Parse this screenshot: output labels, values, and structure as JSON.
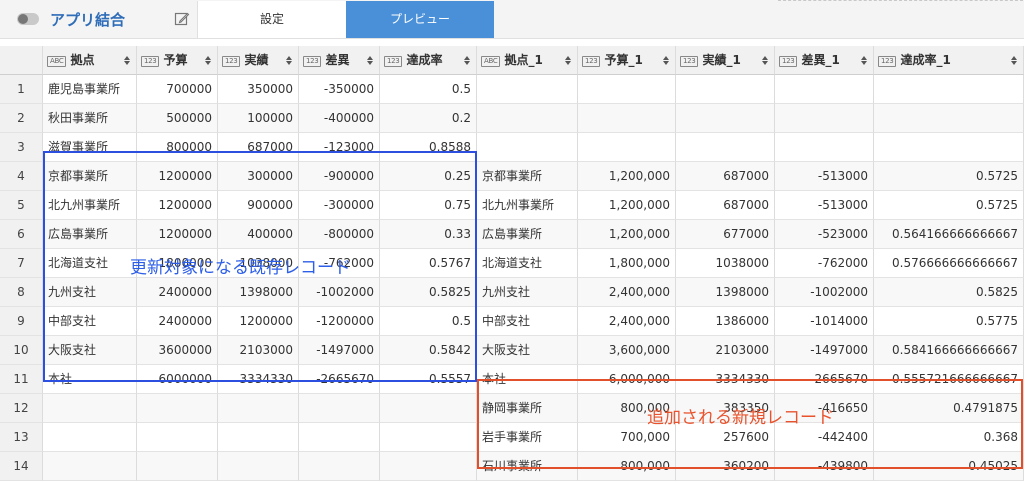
{
  "app": {
    "title": "アプリ結合",
    "toggle_icon": "toggle-icon",
    "edit_icon": "edit-icon"
  },
  "tabs": [
    {
      "label": "設定",
      "active": false
    },
    {
      "label": "プレビュー",
      "active": true
    }
  ],
  "colors": {
    "accent": "#4a90d9",
    "title": "#2f6db8",
    "annotation_blue": "#2d4fe0",
    "annotation_red": "#e2502b"
  },
  "table": {
    "columns": [
      {
        "label": "拠点",
        "type": "ABC"
      },
      {
        "label": "予算",
        "type": "123"
      },
      {
        "label": "実績",
        "type": "123"
      },
      {
        "label": "差異",
        "type": "123"
      },
      {
        "label": "達成率",
        "type": "123"
      },
      {
        "label": "拠点_1",
        "type": "ABC"
      },
      {
        "label": "予算_1",
        "type": "123"
      },
      {
        "label": "実績_1",
        "type": "123"
      },
      {
        "label": "差異_1",
        "type": "123"
      },
      {
        "label": "達成率_1",
        "type": "123"
      }
    ],
    "rows": [
      [
        "1",
        "鹿児島事業所",
        "700000",
        "350000",
        "-350000",
        "0.5",
        "",
        "",
        "",
        "",
        ""
      ],
      [
        "2",
        "秋田事業所",
        "500000",
        "100000",
        "-400000",
        "0.2",
        "",
        "",
        "",
        "",
        ""
      ],
      [
        "3",
        "滋賀事業所",
        "800000",
        "687000",
        "-123000",
        "0.8588",
        "",
        "",
        "",
        "",
        ""
      ],
      [
        "4",
        "京都事業所",
        "1200000",
        "300000",
        "-900000",
        "0.25",
        "京都事業所",
        "1,200,000",
        "687000",
        "-513000",
        "0.5725"
      ],
      [
        "5",
        "北九州事業所",
        "1200000",
        "900000",
        "-300000",
        "0.75",
        "北九州事業所",
        "1,200,000",
        "687000",
        "-513000",
        "0.5725"
      ],
      [
        "6",
        "広島事業所",
        "1200000",
        "400000",
        "-800000",
        "0.33",
        "広島事業所",
        "1,200,000",
        "677000",
        "-523000",
        "0.564166666666667"
      ],
      [
        "7",
        "北海道支社",
        "1800000",
        "1038000",
        "-762000",
        "0.5767",
        "北海道支社",
        "1,800,000",
        "1038000",
        "-762000",
        "0.576666666666667"
      ],
      [
        "8",
        "九州支社",
        "2400000",
        "1398000",
        "-1002000",
        "0.5825",
        "九州支社",
        "2,400,000",
        "1398000",
        "-1002000",
        "0.5825"
      ],
      [
        "9",
        "中部支社",
        "2400000",
        "1200000",
        "-1200000",
        "0.5",
        "中部支社",
        "2,400,000",
        "1386000",
        "-1014000",
        "0.5775"
      ],
      [
        "10",
        "大阪支社",
        "3600000",
        "2103000",
        "-1497000",
        "0.5842",
        "大阪支社",
        "3,600,000",
        "2103000",
        "-1497000",
        "0.584166666666667"
      ],
      [
        "11",
        "本社",
        "6000000",
        "3334330",
        "-2665670",
        "0.5557",
        "本社",
        "6,000,000",
        "3334330",
        "-2665670",
        "0.555721666666667"
      ],
      [
        "12",
        "",
        "",
        "",
        "",
        "",
        "静岡事業所",
        "800,000",
        "383350",
        "-416650",
        "0.4791875"
      ],
      [
        "13",
        "",
        "",
        "",
        "",
        "",
        "岩手事業所",
        "700,000",
        "257600",
        "-442400",
        "0.368"
      ],
      [
        "14",
        "",
        "",
        "",
        "",
        "",
        "石川事業所",
        "800,000",
        "360200",
        "-439800",
        "0.45025"
      ]
    ]
  },
  "annotations": {
    "existing_records": "更新対象になる既存レコード",
    "new_records": "追加される新規レコード"
  }
}
